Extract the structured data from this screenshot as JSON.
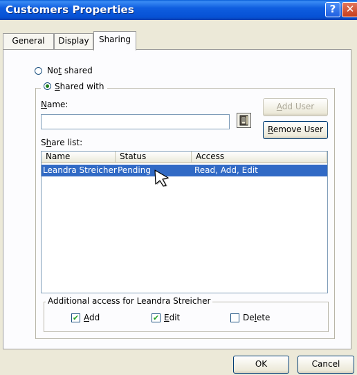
{
  "window": {
    "title": "Customers Properties",
    "help_glyph": "?",
    "close_glyph": "✕"
  },
  "tabs": [
    {
      "label": "General"
    },
    {
      "label": "Display"
    },
    {
      "label": "Sharing"
    }
  ],
  "sharing": {
    "not_shared": {
      "pre": "No",
      "acc": "t",
      "post": " shared",
      "selected": false
    },
    "shared_with": {
      "pre": "",
      "acc": "S",
      "post": "hared with",
      "selected": true
    },
    "name_label": {
      "acc": "N",
      "post": "ame:"
    },
    "name_value": "",
    "address_book_icon": "address-book-icon",
    "add_user": {
      "acc": "A",
      "post": "dd User",
      "enabled": false
    },
    "remove_user": {
      "acc": "R",
      "post": "emove User"
    },
    "share_list_label": {
      "pre": "S",
      "acc": "h",
      "post": "are list:"
    },
    "columns": [
      "Name",
      "Status",
      "Access"
    ],
    "rows": [
      {
        "name": "Leandra Streicher",
        "status": "Pending",
        "access": "Read, Add, Edit",
        "selected": true
      }
    ],
    "additional_access_label": "Additional access for Leandra Streicher",
    "checkboxes": [
      {
        "acc": "A",
        "post": "dd",
        "checked": true
      },
      {
        "acc": "E",
        "post": "dit",
        "checked": true
      },
      {
        "pre": "De",
        "acc": "l",
        "post": "ete",
        "checked": false
      }
    ]
  },
  "footer": {
    "ok": "OK",
    "cancel": "Cancel"
  },
  "colors": {
    "selection": "#316ac5",
    "face": "#ece9d8",
    "check": "#21a121"
  }
}
